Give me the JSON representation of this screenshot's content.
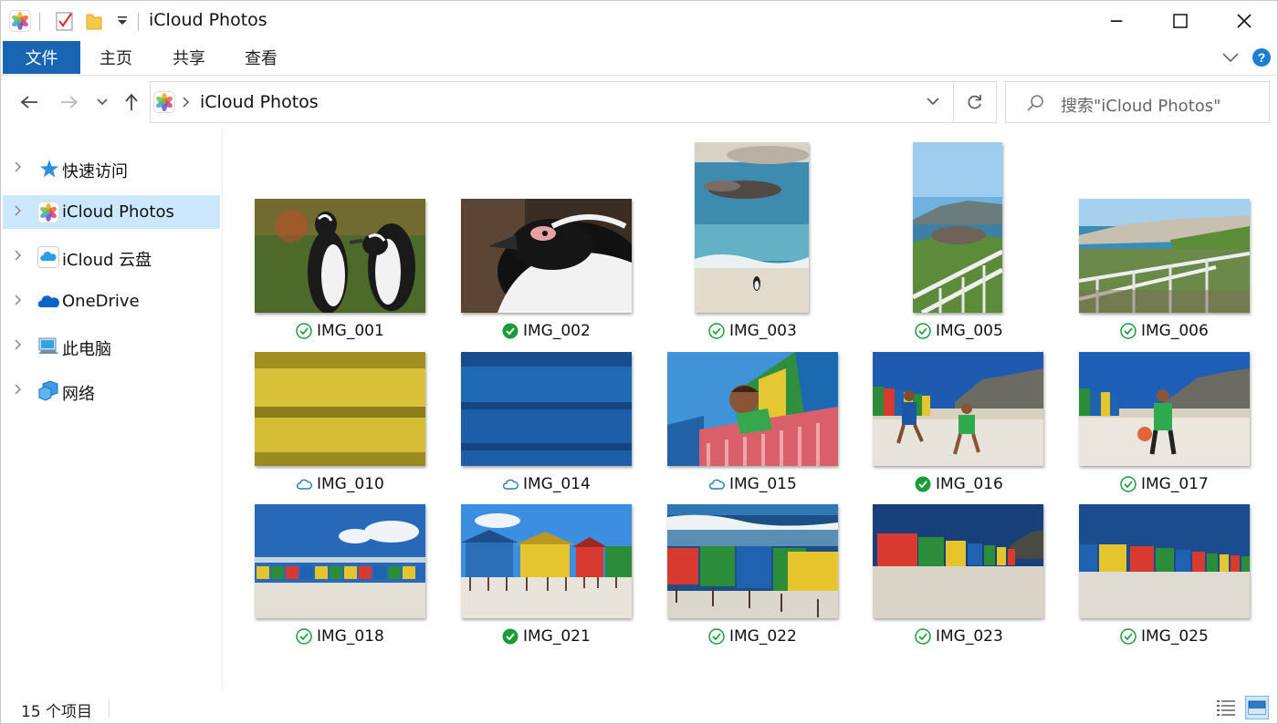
{
  "window": {
    "title": "iCloud Photos",
    "minimize": "─",
    "maximize": "☐",
    "close": "✕"
  },
  "ribbon": {
    "tabs": [
      "文件",
      "主页",
      "共享",
      "查看"
    ]
  },
  "address": {
    "path": "iCloud Photos",
    "search_placeholder": "搜索\"iCloud Photos\""
  },
  "sidebar": {
    "items": [
      {
        "label": "快速访问",
        "icon": "star-icon"
      },
      {
        "label": "iCloud Photos",
        "icon": "photos-icon",
        "selected": true
      },
      {
        "label": "iCloud 云盘",
        "icon": "icloud-drive-icon"
      },
      {
        "label": "OneDrive",
        "icon": "onedrive-icon"
      },
      {
        "label": "此电脑",
        "icon": "computer-icon"
      },
      {
        "label": "网络",
        "icon": "network-icon"
      }
    ]
  },
  "files": [
    {
      "name": "IMG_001",
      "status": "available"
    },
    {
      "name": "IMG_002",
      "status": "always-keep"
    },
    {
      "name": "IMG_003",
      "status": "available"
    },
    {
      "name": "IMG_005",
      "status": "available"
    },
    {
      "name": "IMG_006",
      "status": "available"
    },
    {
      "name": "IMG_010",
      "status": "cloud"
    },
    {
      "name": "IMG_014",
      "status": "cloud"
    },
    {
      "name": "IMG_015",
      "status": "cloud"
    },
    {
      "name": "IMG_016",
      "status": "always-keep"
    },
    {
      "name": "IMG_017",
      "status": "available"
    },
    {
      "name": "IMG_018",
      "status": "available"
    },
    {
      "name": "IMG_021",
      "status": "always-keep"
    },
    {
      "name": "IMG_022",
      "status": "available"
    },
    {
      "name": "IMG_023",
      "status": "available"
    },
    {
      "name": "IMG_025",
      "status": "available"
    }
  ],
  "statusbar": {
    "item_count": "15 个项目"
  },
  "colors": {
    "accent": "#1a64b4",
    "selection": "#cce8ff",
    "sync_green": "#1a9c3a",
    "cloud_blue": "#1f79c9"
  }
}
